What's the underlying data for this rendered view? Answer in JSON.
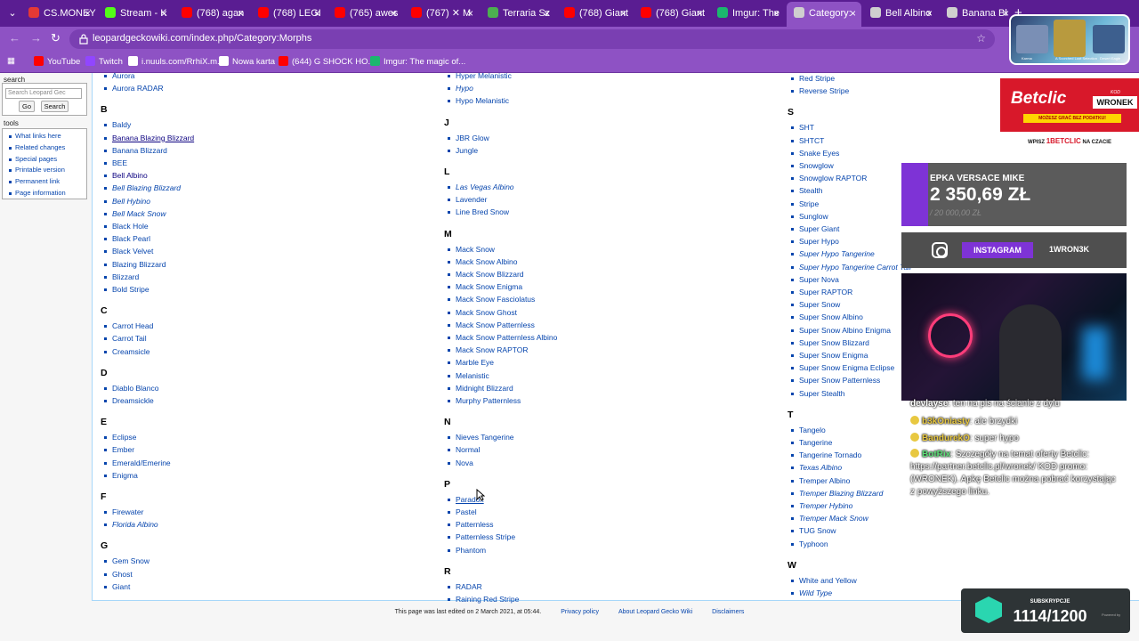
{
  "tabs": [
    {
      "title": "CS.MONEY",
      "color": "#e53935"
    },
    {
      "title": "Stream - K",
      "color": "#53fc18"
    },
    {
      "title": "(768) agan",
      "color": "#ff0000"
    },
    {
      "title": "(768) LEGI",
      "color": "#ff0000"
    },
    {
      "title": "(765) awes",
      "color": "#ff0000"
    },
    {
      "title": "(767) ✕ M",
      "color": "#ff0000"
    },
    {
      "title": "Terraria Sz",
      "color": "#4caf50"
    },
    {
      "title": "(768) Giant",
      "color": "#ff0000"
    },
    {
      "title": "(768) Giant",
      "color": "#ff0000"
    },
    {
      "title": "Imgur: The",
      "color": "#1bb76e"
    },
    {
      "title": "Category:",
      "color": "#cfcfcf",
      "active": true
    },
    {
      "title": "Bell Albino",
      "color": "#cfcfcf"
    },
    {
      "title": "Banana Bl",
      "color": "#cfcfcf"
    }
  ],
  "browser": {
    "url": "leopardgeckowiki.com/index.php/Category:Morphs",
    "new_tab": "+"
  },
  "bookmarks": [
    {
      "label": "YouTube",
      "color": "#ff0000"
    },
    {
      "label": "Twitch",
      "color": "#9146ff"
    },
    {
      "label": "i.nuuls.com/RrhiX.m...",
      "color": "#ffffff"
    },
    {
      "label": "Nowa karta",
      "color": "#ffffff"
    },
    {
      "label": "(644) G SHOCK HO...",
      "color": "#ff0000"
    },
    {
      "label": "Imgur: The magic of...",
      "color": "#1bb76e"
    }
  ],
  "sidebar": {
    "search_heading": "search",
    "search_placeholder": "Search Leopard Gec",
    "go_label": "Go",
    "search_label": "Search",
    "tools_heading": "tools",
    "tools": [
      "What links here",
      "Related changes",
      "Special pages",
      "Printable version",
      "Permanent link",
      "Page information"
    ]
  },
  "columns": [
    {
      "groups": [
        {
          "letter": "",
          "items": [
            {
              "t": "Aurora"
            },
            {
              "t": "Aurora RADAR"
            }
          ]
        },
        {
          "letter": "B",
          "items": [
            {
              "t": "Baldy"
            },
            {
              "t": "Banana Blazing Blizzard",
              "v": true,
              "u": true
            },
            {
              "t": "Banana Blizzard"
            },
            {
              "t": "BEE"
            },
            {
              "t": "Bell Albino",
              "v": true
            },
            {
              "t": "Bell Blazing Blizzard",
              "i": true
            },
            {
              "t": "Bell Hybino",
              "i": true
            },
            {
              "t": "Bell Mack Snow",
              "i": true
            },
            {
              "t": "Black Hole"
            },
            {
              "t": "Black Pearl"
            },
            {
              "t": "Black Velvet"
            },
            {
              "t": "Blazing Blizzard"
            },
            {
              "t": "Blizzard"
            },
            {
              "t": "Bold Stripe"
            }
          ]
        },
        {
          "letter": "C",
          "items": [
            {
              "t": "Carrot Head"
            },
            {
              "t": "Carrot Tail"
            },
            {
              "t": "Creamsicle"
            }
          ]
        },
        {
          "letter": "D",
          "items": [
            {
              "t": "Diablo Blanco"
            },
            {
              "t": "Dreamsickle"
            }
          ]
        },
        {
          "letter": "E",
          "items": [
            {
              "t": "Eclipse"
            },
            {
              "t": "Ember"
            },
            {
              "t": "Emerald/Emerine"
            },
            {
              "t": "Enigma"
            }
          ]
        },
        {
          "letter": "F",
          "items": [
            {
              "t": "Firewater"
            },
            {
              "t": "Florida Albino",
              "i": true
            }
          ]
        },
        {
          "letter": "G",
          "items": [
            {
              "t": "Gem Snow"
            },
            {
              "t": "Ghost"
            },
            {
              "t": "Giant"
            }
          ]
        }
      ]
    },
    {
      "groups": [
        {
          "letter": "",
          "items": [
            {
              "t": "Hyper Melanistic"
            },
            {
              "t": "Hypo",
              "i": true
            },
            {
              "t": "Hypo Melanistic"
            }
          ]
        },
        {
          "letter": "J",
          "items": [
            {
              "t": "JBR Glow"
            },
            {
              "t": "Jungle"
            }
          ]
        },
        {
          "letter": "L",
          "items": [
            {
              "t": "Las Vegas Albino",
              "i": true
            },
            {
              "t": "Lavender"
            },
            {
              "t": "Line Bred Snow"
            }
          ]
        },
        {
          "letter": "M",
          "items": [
            {
              "t": "Mack Snow"
            },
            {
              "t": "Mack Snow Albino"
            },
            {
              "t": "Mack Snow Blizzard"
            },
            {
              "t": "Mack Snow Enigma"
            },
            {
              "t": "Mack Snow Fasciolatus"
            },
            {
              "t": "Mack Snow Ghost"
            },
            {
              "t": "Mack Snow Patternless"
            },
            {
              "t": "Mack Snow Patternless Albino"
            },
            {
              "t": "Mack Snow RAPTOR"
            },
            {
              "t": "Marble Eye"
            },
            {
              "t": "Melanistic"
            },
            {
              "t": "Midnight Blizzard"
            },
            {
              "t": "Murphy Patternless"
            }
          ]
        },
        {
          "letter": "N",
          "items": [
            {
              "t": "Nieves Tangerine"
            },
            {
              "t": "Normal"
            },
            {
              "t": "Nova"
            }
          ]
        },
        {
          "letter": "P",
          "items": [
            {
              "t": "Paradox",
              "u": true
            },
            {
              "t": "Pastel"
            },
            {
              "t": "Patternless"
            },
            {
              "t": "Patternless Stripe"
            },
            {
              "t": "Phantom"
            }
          ]
        },
        {
          "letter": "R",
          "items": [
            {
              "t": "RADAR"
            },
            {
              "t": "Raining Red Stripe"
            }
          ]
        }
      ]
    },
    {
      "groups": [
        {
          "letter": "",
          "items": [
            {
              "t": "Red Stripe"
            },
            {
              "t": "Reverse Stripe"
            }
          ]
        },
        {
          "letter": "S",
          "items": [
            {
              "t": "SHT"
            },
            {
              "t": "SHTCT"
            },
            {
              "t": "Snake Eyes"
            },
            {
              "t": "Snowglow"
            },
            {
              "t": "Snowglow RAPTOR"
            },
            {
              "t": "Stealth"
            },
            {
              "t": "Stripe"
            },
            {
              "t": "Sunglow"
            },
            {
              "t": "Super Giant"
            },
            {
              "t": "Super Hypo"
            },
            {
              "t": "Super Hypo Tangerine",
              "i": true
            },
            {
              "t": "Super Hypo Tangerine Carrot Tail",
              "i": true
            },
            {
              "t": "Super Nova"
            },
            {
              "t": "Super RAPTOR"
            },
            {
              "t": "Super Snow"
            },
            {
              "t": "Super Snow Albino"
            },
            {
              "t": "Super Snow Albino Enigma"
            },
            {
              "t": "Super Snow Blizzard"
            },
            {
              "t": "Super Snow Enigma"
            },
            {
              "t": "Super Snow Enigma Eclipse"
            },
            {
              "t": "Super Snow Patternless"
            },
            {
              "t": "Super Stealth"
            }
          ]
        },
        {
          "letter": "T",
          "items": [
            {
              "t": "Tangelo"
            },
            {
              "t": "Tangerine"
            },
            {
              "t": "Tangerine Tornado"
            },
            {
              "t": "Texas Albino",
              "i": true
            },
            {
              "t": "Tremper Albino"
            },
            {
              "t": "Tremper Blazing Blizzard",
              "i": true
            },
            {
              "t": "Tremper Hybino",
              "i": true
            },
            {
              "t": "Tremper Mack Snow",
              "i": true
            },
            {
              "t": "TUG Snow"
            },
            {
              "t": "Typhoon"
            }
          ]
        },
        {
          "letter": "W",
          "items": [
            {
              "t": "White and Yellow"
            },
            {
              "t": "Wild Type",
              "i": true
            }
          ]
        }
      ]
    }
  ],
  "footer": {
    "last_edited": "This page was last edited on 2 March 2021, at 05:44.",
    "privacy": "Privacy policy",
    "about": "About Leopard Gecko Wiki",
    "disclaimers": "Disclaimers"
  },
  "overlay": {
    "topright_caps": [
      "Karma",
      "A Scorched Loot Selection",
      "Desert Eagle"
    ],
    "betclic_logo": "Betclic",
    "betclic_kod_label": "KOD",
    "betclic_kod": "WRONEK",
    "betclic_promo": "MOŻESZ GRAĆ BEZ PODATKU!",
    "wpisz": "WPISZ",
    "wpisz_code": "1BETCLIC",
    "wpisz_tail": "NA CZACIE",
    "donation_title": "EPKA VERSACE MIKE",
    "donation_value": "2 350,69 ZŁ",
    "donation_goal": "/ 20 000,00 ZŁ",
    "instagram_label": "INSTAGRAM",
    "instagram_handle": "1WRON3K",
    "chat": [
      {
        "user": "devlayse",
        "msg": "ten na pis na ścianie z dylu",
        "color": "#ffffff",
        "badge": ""
      },
      {
        "user": "b3kOniasty",
        "msg": "ale brzydki",
        "color": "#e8c840",
        "badge": "#e8c840"
      },
      {
        "user": "BandurekO",
        "msg": "super hypo",
        "color": "#e8c840",
        "badge": "#e8c840"
      }
    ],
    "bot_user": "BotRix",
    "bot_msg": "Szczegóły na temat oferty Betclic: https://partner.betclic.pl/wronek/ KOD promo: (WRONEK). Apkę Betclic można pobrać korzystając z powyższego linku.",
    "subs_label": "SUBSKRYPCJE",
    "subs_value": "1114/1200",
    "subs_powered": "Powered by"
  }
}
